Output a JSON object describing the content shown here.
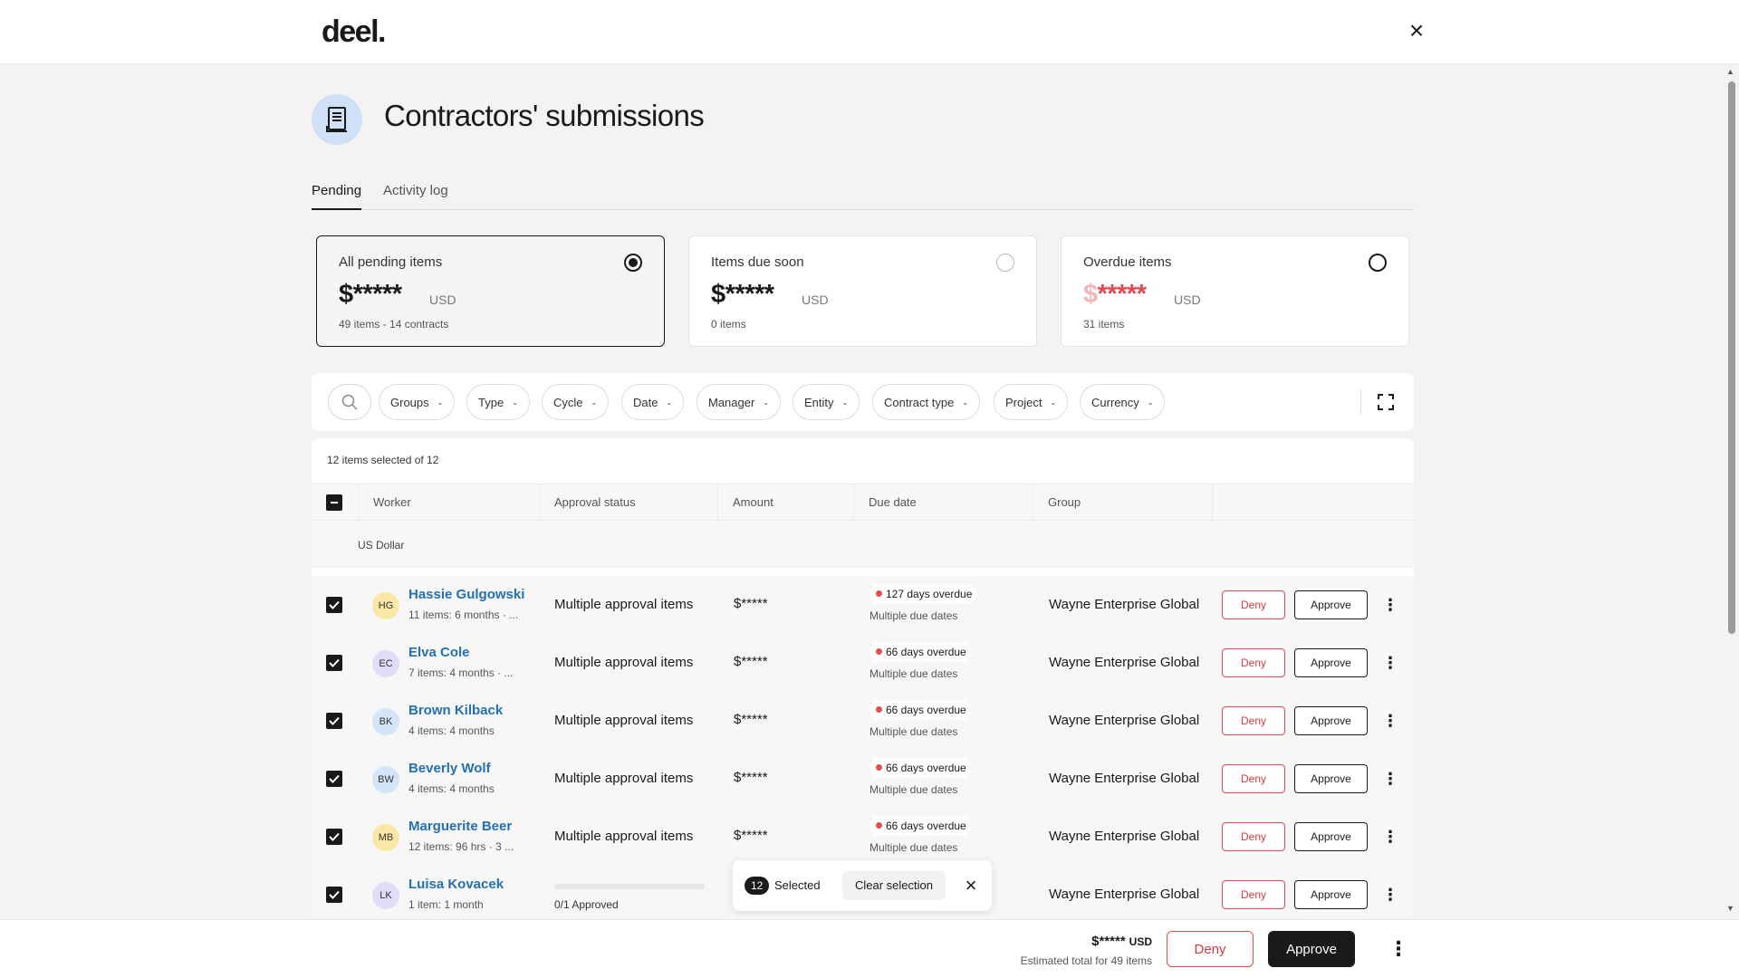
{
  "app": {
    "logo": "deel.",
    "close_icon": "close-icon"
  },
  "page": {
    "title": "Contractors' submissions",
    "icon": "receipt-icon"
  },
  "tabs": [
    {
      "label": "Pending",
      "active": true
    },
    {
      "label": "Activity log",
      "active": false
    }
  ],
  "cards": [
    {
      "title": "All pending items",
      "amount": "$*****",
      "currency": "USD",
      "sub": "49 items - 14 contracts",
      "selected": true
    },
    {
      "title": "Items due soon",
      "amount": "$*****",
      "currency": "USD",
      "sub": "0 items",
      "selected": false
    },
    {
      "title": "Overdue items",
      "amount": "$*****",
      "currency": "USD",
      "sub": "31 items",
      "selected": false
    }
  ],
  "filters": [
    "Groups",
    "Type",
    "Cycle",
    "Date",
    "Manager",
    "Entity",
    "Contract type",
    "Project",
    "Currency"
  ],
  "table": {
    "selection_text": "12 items selected of 12",
    "columns": [
      "Worker",
      "Approval status",
      "Amount",
      "Due date",
      "Group"
    ],
    "group_label": "US Dollar",
    "deny_label": "Deny",
    "approve_label": "Approve",
    "rows": [
      {
        "initials": "HG",
        "avatar_color": "#fbe7a5",
        "name": "Hassie Gulgowski",
        "sub": "11 items: 6 months · ...",
        "status": "Multiple approval items",
        "amount": "$*****",
        "due": "127 days overdue",
        "due_sub": "Multiple due dates",
        "group": "Wayne Enterprise Global"
      },
      {
        "initials": "EC",
        "avatar_color": "#e3dcf7",
        "name": "Elva Cole",
        "sub": "7 items: 4 months · ...",
        "status": "Multiple approval items",
        "amount": "$*****",
        "due": "66 days overdue",
        "due_sub": "Multiple due dates",
        "group": "Wayne Enterprise Global"
      },
      {
        "initials": "BK",
        "avatar_color": "#d4e5f8",
        "name": "Brown Kilback",
        "sub": "4 items: 4 months",
        "status": "Multiple approval items",
        "amount": "$*****",
        "due": "66 days overdue",
        "due_sub": "Multiple due dates",
        "group": "Wayne Enterprise Global"
      },
      {
        "initials": "BW",
        "avatar_color": "#d4e5f8",
        "name": "Beverly Wolf",
        "sub": "4 items: 4 months",
        "status": "Multiple approval items",
        "amount": "$*****",
        "due": "66 days overdue",
        "due_sub": "Multiple due dates",
        "group": "Wayne Enterprise Global"
      },
      {
        "initials": "MB",
        "avatar_color": "#fbe7a5",
        "name": "Marguerite Beer",
        "sub": "12 items: 96 hrs · 3 ...",
        "status": "Multiple approval items",
        "amount": "$*****",
        "due": "66 days overdue",
        "due_sub": "Multiple due dates",
        "group": "Wayne Enterprise Global"
      },
      {
        "initials": "LK",
        "avatar_color": "#e3dcf7",
        "name": "Luisa Kovacek",
        "sub": "1 item: 1 month",
        "progress_label": "0/1 Approved",
        "progress_fraction": 0,
        "group": "Wayne Enterprise Global"
      }
    ]
  },
  "selection_toast": {
    "count": "12",
    "label": "Selected",
    "clear_label": "Clear selection"
  },
  "bottom_bar": {
    "total": "$*****",
    "currency": "USD",
    "sub": "Estimated total for 49 items",
    "deny_label": "Deny",
    "approve_label": "Approve"
  }
}
